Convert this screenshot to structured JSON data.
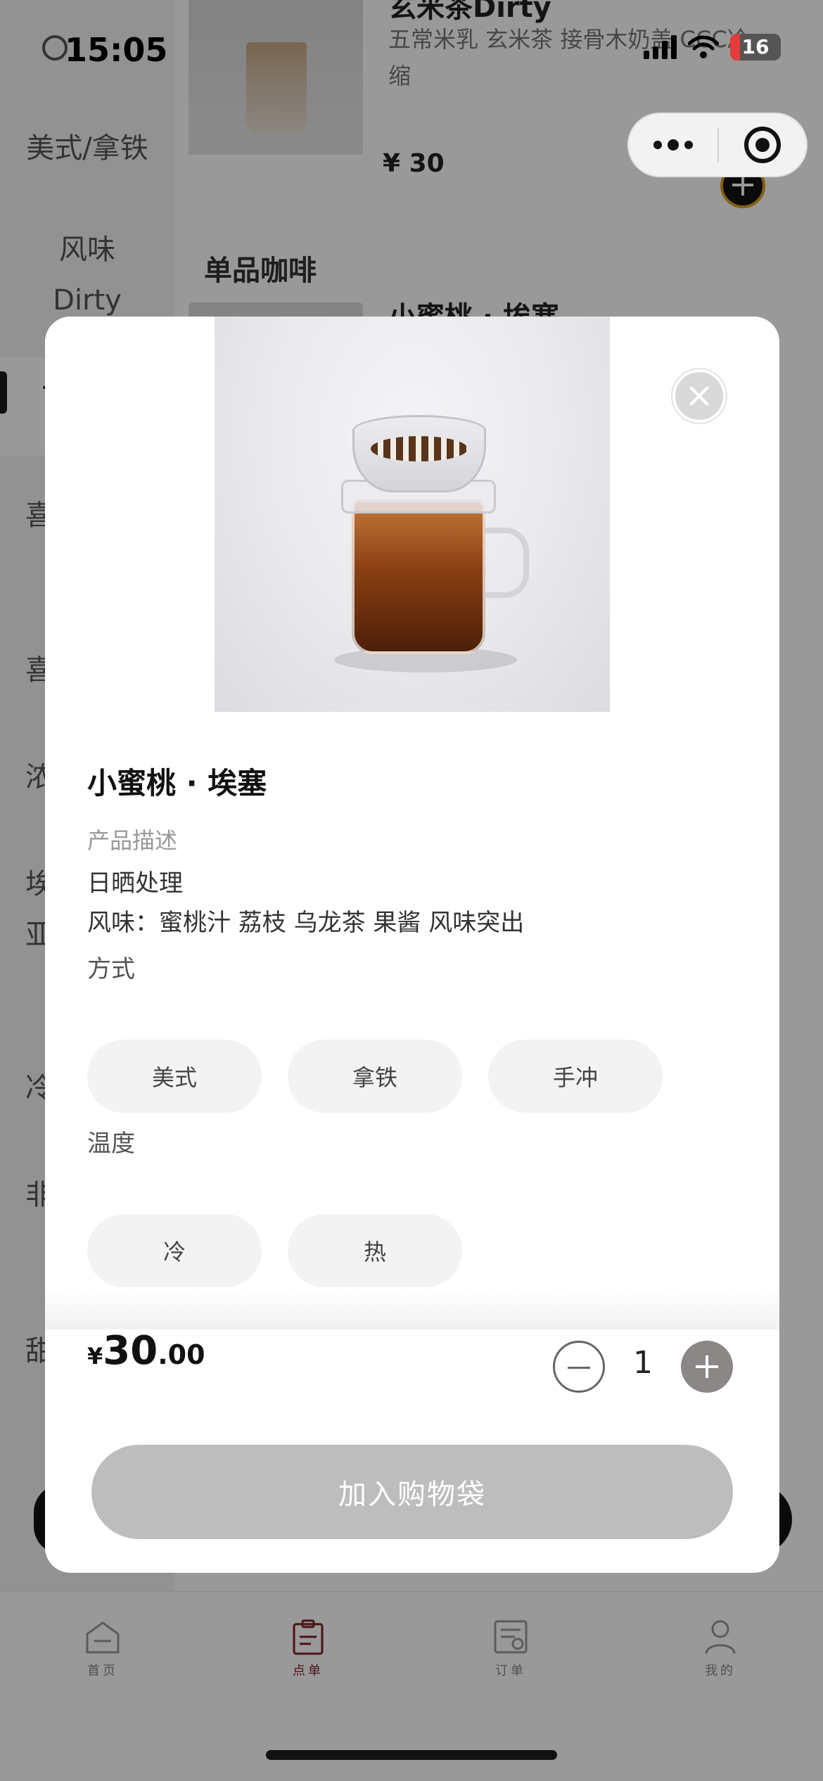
{
  "status_bar": {
    "time": "15:05",
    "battery": "16"
  },
  "background": {
    "sidebar": {
      "items": [
        "美式/拿铁",
        "风味",
        "Dirty"
      ],
      "active_label": "单",
      "peek_labels": [
        "喜",
        "喜",
        "浓",
        "埃",
        "亚",
        "冷",
        "非",
        "甜"
      ]
    },
    "product": {
      "title": "玄米茶Dirty",
      "description": "五常米乳 玄米茶 接骨木奶盖 CCC冷缩",
      "price": "¥ 30"
    },
    "section_title": "单品咖啡",
    "next_item_title": "小蜜桃 · 埃塞"
  },
  "tabbar": {
    "items": [
      {
        "label": "首页",
        "icon": "home-icon"
      },
      {
        "label": "点单",
        "icon": "clipboard-icon"
      },
      {
        "label": "订单",
        "icon": "order-list-icon"
      },
      {
        "label": "我的",
        "icon": "user-icon"
      }
    ]
  },
  "modal": {
    "product_name": "小蜜桃 · 埃塞",
    "description_label": "产品描述",
    "description_lines": [
      "日晒处理",
      "风味：蜜桃汁 荔枝 乌龙茶 果酱 风味突出"
    ],
    "option_groups": [
      {
        "label": "方式",
        "options": [
          "美式",
          "拿铁",
          "手冲"
        ]
      },
      {
        "label": "温度",
        "options": [
          "冷",
          "热"
        ]
      }
    ],
    "price": {
      "currency": "¥",
      "integer": "30",
      "decimal": ".00"
    },
    "quantity": "1",
    "add_button_label": "加入购物袋"
  },
  "colors": {
    "accent": "#7a1f2b",
    "disabled_button": "#bdbdbd",
    "chip_bg": "#f3f3f3",
    "battery_low": "#e43b3b"
  }
}
